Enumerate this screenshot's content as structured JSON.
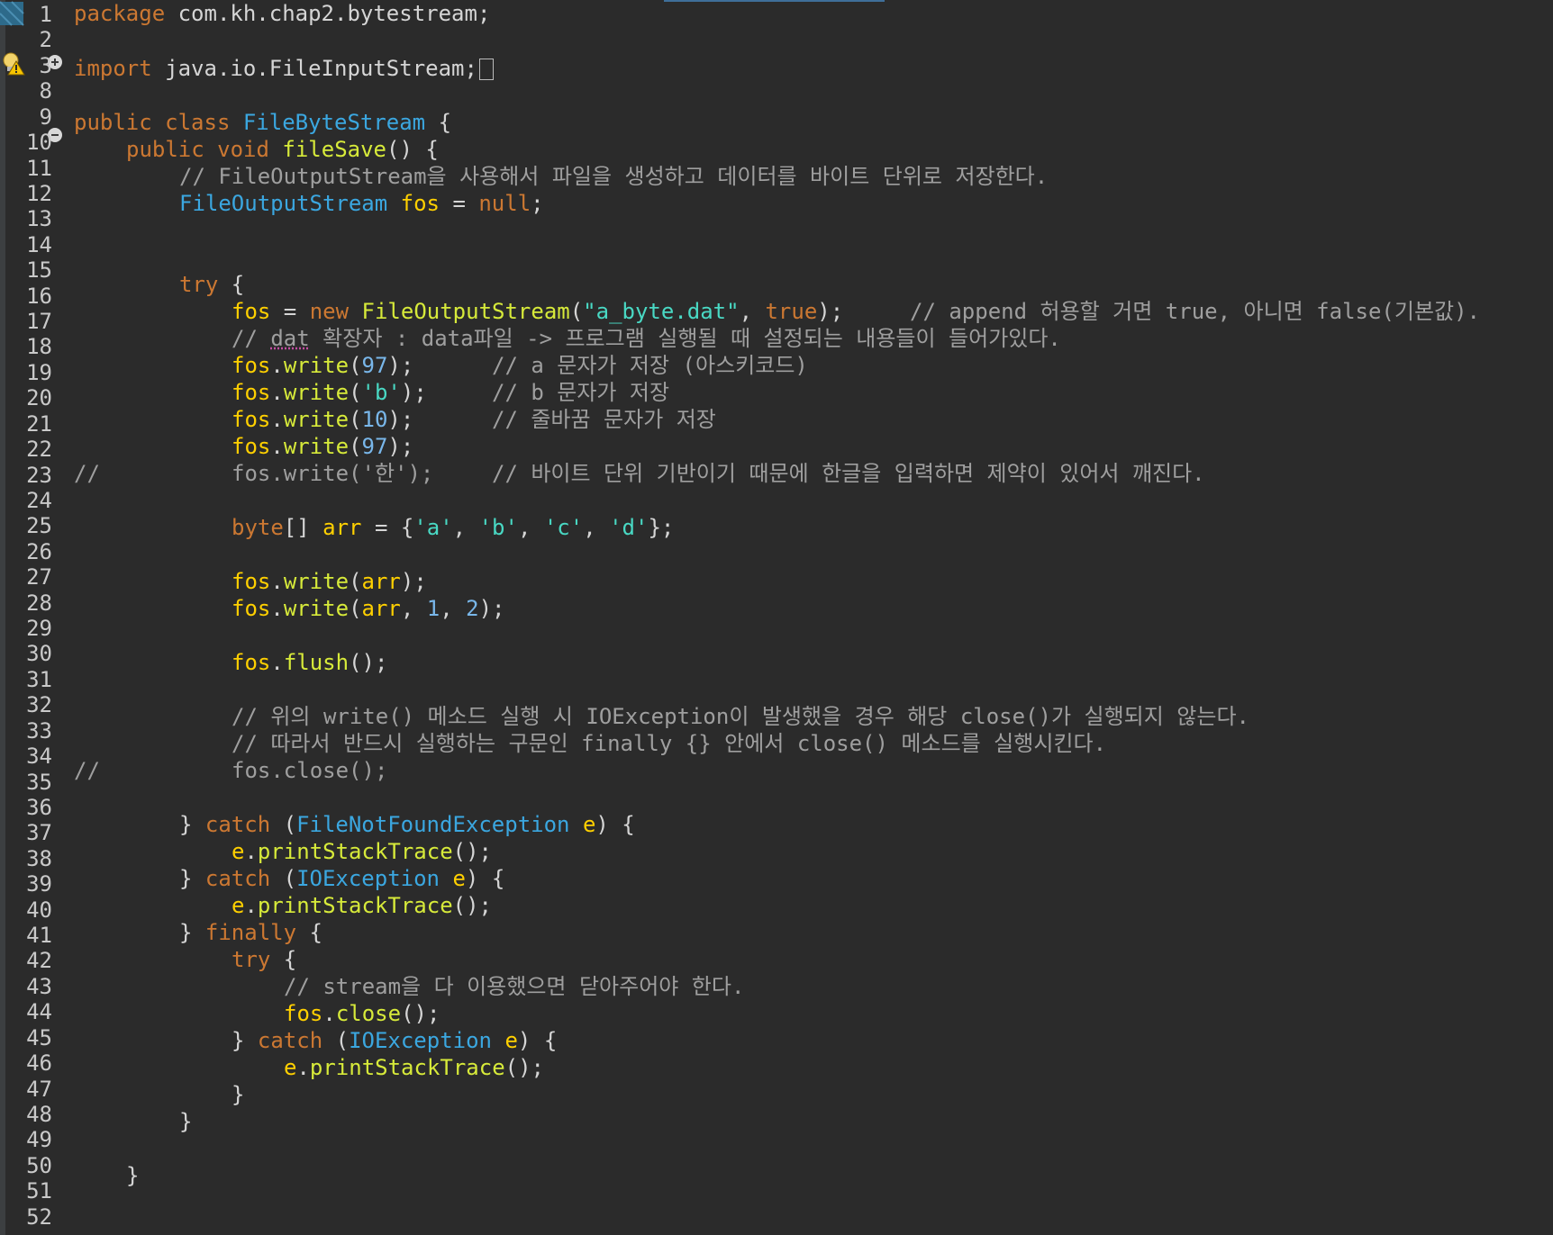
{
  "editor": {
    "line_numbers": [
      "1",
      "2",
      "3",
      "8",
      "9",
      "10",
      "11",
      "12",
      "13",
      "14",
      "15",
      "16",
      "17",
      "18",
      "19",
      "20",
      "21",
      "22",
      "23",
      "24",
      "25",
      "26",
      "27",
      "28",
      "29",
      "30",
      "31",
      "32",
      "33",
      "34",
      "35",
      "36",
      "37",
      "38",
      "39",
      "40",
      "41",
      "42",
      "43",
      "44",
      "45",
      "46",
      "47",
      "48",
      "49",
      "50",
      "51",
      "52"
    ],
    "markers": {
      "warning": "warning-lightbulb-icon",
      "expand": "expand-fold-icon",
      "collapse": "collapse-fold-icon"
    },
    "code": {
      "l1": {
        "kw": "package",
        "rest": " com.kh.chap2.bytestream;"
      },
      "l3": {
        "kw": "import",
        "rest": " java.io.FileInputStream;"
      },
      "l9": {
        "kw": "public class",
        "type": "FileByteStream",
        "rest": " {"
      },
      "l10": {
        "kw": "public void",
        "method": "fileSave",
        "rest": "() {"
      },
      "l11": {
        "comment": "// FileOutputStream을 사용해서 파일을 생성하고 데이터를 바이트 단위로 저장한다."
      },
      "l12": {
        "type": "FileOutputStream",
        "var": "fos",
        "eq": " = ",
        "kw": "null",
        "semi": ";"
      },
      "l15": {
        "kw": "try",
        "rest": " {"
      },
      "l16": {
        "var": "fos",
        "eq": " = ",
        "kw": "new",
        "ctor": "FileOutputStream",
        "open": "(",
        "str": "\"a_byte.dat\"",
        "comma": ", ",
        "bool": "true",
        "close": ");",
        "comment": "// append 허용할 거면 true, 아니면 false(기본값)."
      },
      "l17": {
        "c1": "// ",
        "underlined": "dat",
        "c2": " 확장자 : data파일 -> 프로그램 실행될 때 설정되는 내용들이 들어가있다."
      },
      "l18": {
        "var": "fos",
        "dot": ".",
        "method": "write",
        "open": "(",
        "num": "97",
        "close": ");",
        "comment": "// a 문자가 저장 (아스키코드)"
      },
      "l19": {
        "var": "fos",
        "dot": ".",
        "method": "write",
        "open": "(",
        "str": "'b'",
        "close": ");",
        "comment": "// b 문자가 저장"
      },
      "l20": {
        "var": "fos",
        "dot": ".",
        "method": "write",
        "open": "(",
        "num": "10",
        "close": ");",
        "comment": "// 줄바꿈 문자가 저장"
      },
      "l21": {
        "var": "fos",
        "dot": ".",
        "method": "write",
        "open": "(",
        "num": "97",
        "close": ");"
      },
      "l22": {
        "slashes": "//",
        "code": "fos.write('한');",
        "comment": "// 바이트 단위 기반이기 때문에 한글을 입력하면 제약이 있어서 깨진다."
      },
      "l24": {
        "kw": "byte",
        "brk": "[] ",
        "var": "arr",
        "eq": " = {",
        "s1": "'a'",
        "s2": "'b'",
        "s3": "'c'",
        "s4": "'d'",
        "sep": ", ",
        "end": "};"
      },
      "l26": {
        "var": "fos",
        "dot": ".",
        "method": "write",
        "open": "(",
        "arg": "arr",
        "close": ");"
      },
      "l27": {
        "var": "fos",
        "dot": ".",
        "method": "write",
        "open": "(",
        "arg": "arr",
        "comma": ", ",
        "n1": "1",
        "n2": "2",
        "close": ");"
      },
      "l29": {
        "var": "fos",
        "dot": ".",
        "method": "flush",
        "rest": "();"
      },
      "l31": {
        "comment": "// 위의 write() 메소드 실행 시 IOException이 발생했을 경우 해당 close()가 실행되지 않는다."
      },
      "l32": {
        "comment": "// 따라서 반드시 실행하는 구문인 finally {} 안에서 close() 메소드를 실행시킨다."
      },
      "l33": {
        "slashes": "//",
        "code": "fos.close();"
      },
      "l35": {
        "brace": "} ",
        "kw": "catch",
        "open": " (",
        "type": "FileNotFoundException",
        "var": "e",
        "rest": ") {"
      },
      "l36": {
        "var": "e",
        "dot": ".",
        "method": "printStackTrace",
        "rest": "();"
      },
      "l37": {
        "brace": "} ",
        "kw": "catch",
        "open": " (",
        "type": "IOException",
        "var": "e",
        "rest": ") {"
      },
      "l38": {
        "var": "e",
        "dot": ".",
        "method": "printStackTrace",
        "rest": "();"
      },
      "l39": {
        "brace": "} ",
        "kw": "finally",
        "rest": " {"
      },
      "l40": {
        "kw": "try",
        "rest": " {"
      },
      "l41": {
        "comment": "// stream을 다 이용했으면 닫아주어야 한다."
      },
      "l42": {
        "var": "fos",
        "dot": ".",
        "method": "close",
        "rest": "();"
      },
      "l43": {
        "brace": "} ",
        "kw": "catch",
        "open": " (",
        "type": "IOException",
        "var": "e",
        "rest": ") {"
      },
      "l44": {
        "var": "e",
        "dot": ".",
        "method": "printStackTrace",
        "rest": "();"
      },
      "l45": {
        "brace": "}"
      },
      "l46": {
        "brace": "}"
      },
      "l48": {
        "brace": "}"
      }
    }
  }
}
